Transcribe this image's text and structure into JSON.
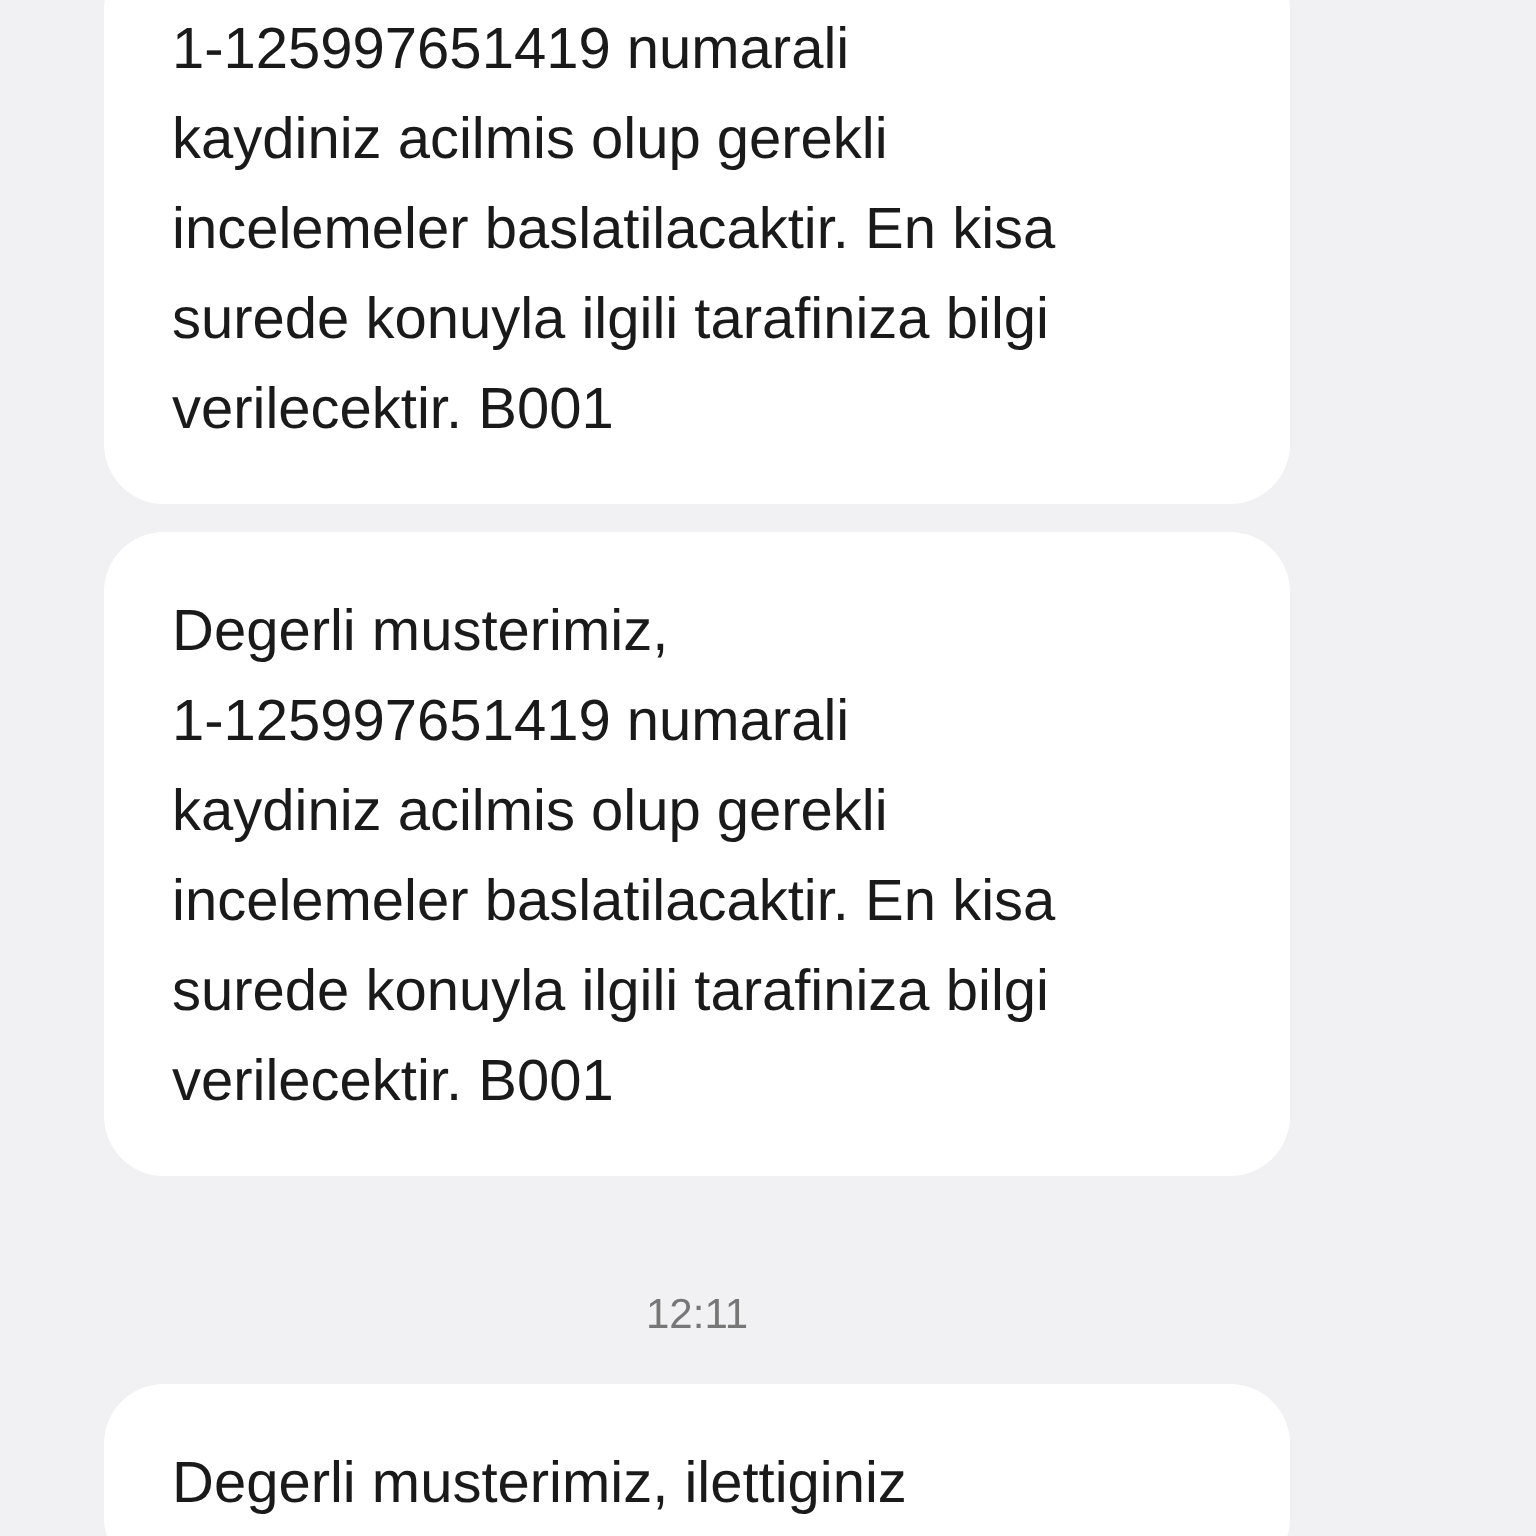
{
  "messages": [
    {
      "kind": "message",
      "lines": [
        "1-125997651419 numarali",
        "kaydiniz acilmis olup gerekli",
        "incelemeler baslatilacaktir. En kisa",
        "surede konuyla ilgili tarafiniza bilgi",
        "verilecektir. B001"
      ]
    },
    {
      "kind": "message",
      "lines": [
        "Degerli musterimiz,",
        "1-125997651419 numarali",
        "kaydiniz acilmis olup gerekli",
        "incelemeler baslatilacaktir. En kisa",
        "surede konuyla ilgili tarafiniza bilgi",
        "verilecektir. B001"
      ]
    },
    {
      "kind": "time",
      "text": "12:11"
    },
    {
      "kind": "message",
      "lines": [
        "Degerli musterimiz, ilettiginiz"
      ]
    }
  ]
}
